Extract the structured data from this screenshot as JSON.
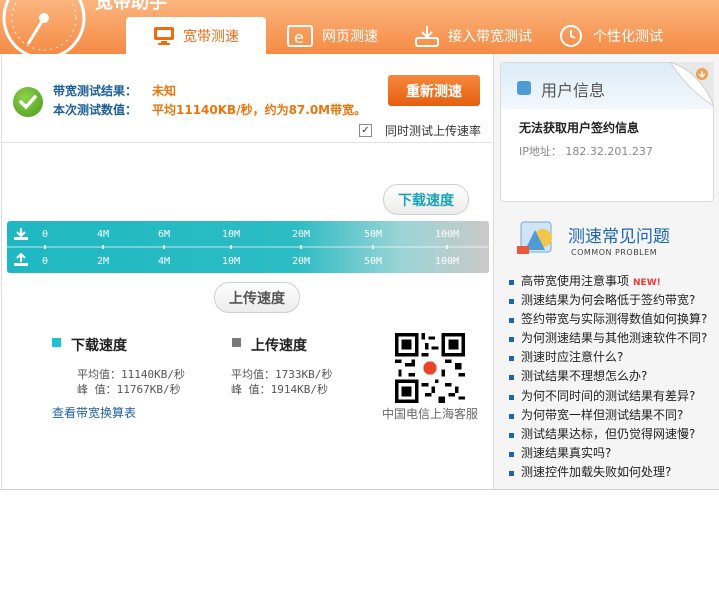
{
  "app": {
    "title": "宽带助手"
  },
  "tabs": [
    {
      "label": "宽带测速",
      "icon": "monitor-icon",
      "active": true
    },
    {
      "label": "网页测速",
      "icon": "browser-icon",
      "active": false
    },
    {
      "label": "接入带宽测试",
      "icon": "router-icon",
      "active": false
    },
    {
      "label": "个性化测试",
      "icon": "clock-icon",
      "active": false
    }
  ],
  "result": {
    "result_label": "带宽测试结果：",
    "result_value": "未知",
    "value_label": "本次测试数值：",
    "value_text": "平均11140KB/秒，约为87.0M带宽。",
    "retest_button": "重新测速",
    "upload_check_label": "同时测试上传速率",
    "upload_checked": true
  },
  "speed_bar": {
    "download_bubble": "下载速度",
    "upload_bubble": "上传速度",
    "download_ticks": [
      "0",
      "4M",
      "6M",
      "10M",
      "20M",
      "50M",
      "100M"
    ],
    "upload_ticks": [
      "0",
      "2M",
      "4M",
      "10M",
      "20M",
      "50M",
      "100M"
    ]
  },
  "stats": {
    "download": {
      "title": "下载速度",
      "color": "#1fc2d2",
      "avg": "平均值：11140KB/秒",
      "peak": "峰  值：11767KB/秒"
    },
    "upload": {
      "title": "上传速度",
      "color": "#7a7a7a",
      "avg": "平均值：1733KB/秒",
      "peak": "峰  值：1914KB/秒"
    },
    "conversion_link": "查看带宽换算表",
    "qr_caption": "中国电信上海客服"
  },
  "user_info": {
    "title": "用户信息",
    "message": "无法获取用户签约信息",
    "ip": "IP地址： 182.32.201.237"
  },
  "faq": {
    "title": "测速常见问题",
    "subtitle": "COMMON PROBLEM",
    "new_badge": "NEW!",
    "items": [
      "高带宽使用注意事项",
      "测速结果为何会略低于签约带宽?",
      "签约带宽与实际测得数值如何换算?",
      "为何测速结果与其他测速软件不同?",
      "测速时应注意什么?",
      "测试结果不理想怎么办?",
      "为何不同时间的测试结果有差异?",
      "为何带宽一样但测试结果不同?",
      "测试结果达标，但仍觉得网速慢?",
      "测速结果真实吗?",
      "测速控件加载失败如何处理?"
    ]
  },
  "colors": {
    "accent": "#f58b45",
    "button": "#e86a1a",
    "bar": "#1fb8c2",
    "link": "#1d5f9a"
  }
}
